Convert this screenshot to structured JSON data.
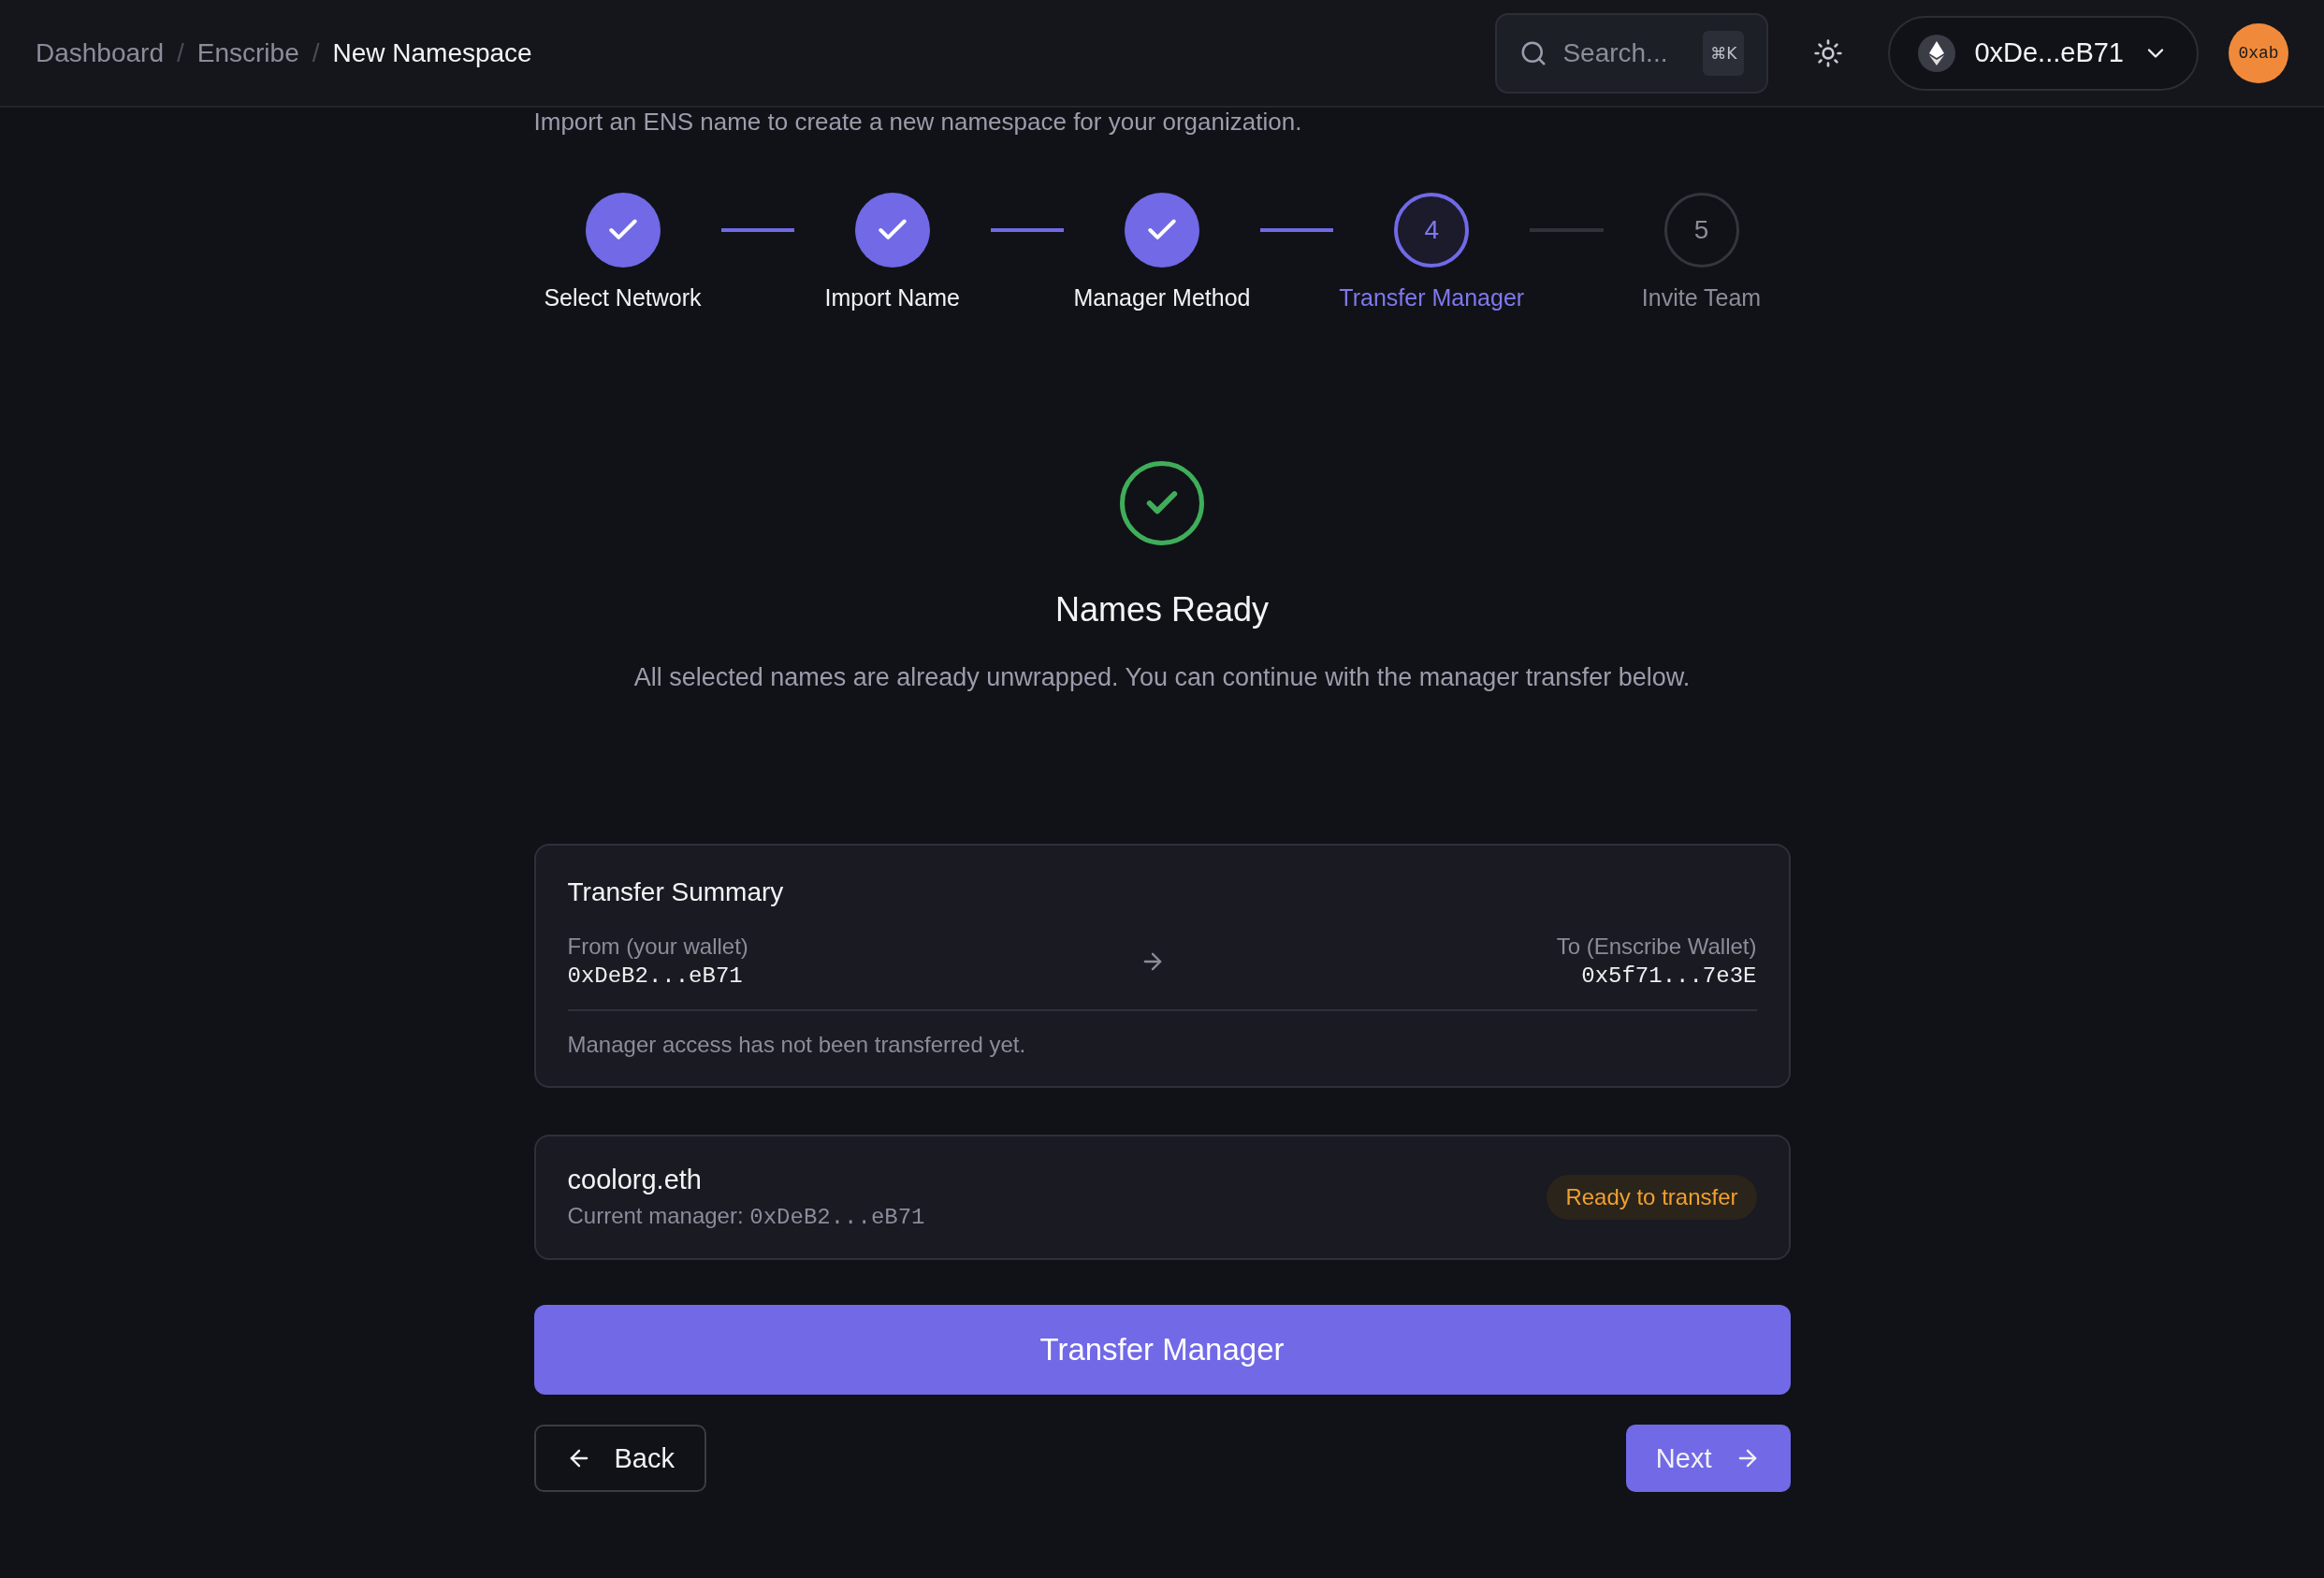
{
  "breadcrumbs": [
    {
      "label": "Dashboard",
      "current": false
    },
    {
      "label": "Enscribe",
      "current": false
    },
    {
      "label": "New Namespace",
      "current": true
    }
  ],
  "breadcrumb_separator": "/",
  "search": {
    "placeholder": "Search...",
    "shortcut": "⌘K"
  },
  "wallet": {
    "label": "0xDe...eB71"
  },
  "avatar": {
    "label": "0xab"
  },
  "subtitle": "Import an ENS name to create a new namespace for your organization.",
  "steps": [
    {
      "label": "Select Network",
      "completed": true,
      "selected": false
    },
    {
      "label": "Import Name",
      "completed": true,
      "selected": false
    },
    {
      "label": "Manager Method",
      "completed": true,
      "selected": false
    },
    {
      "label": "Transfer Manager",
      "number": "4",
      "completed": false,
      "selected": true
    },
    {
      "label": "Invite Team",
      "number": "5",
      "completed": false,
      "selected": false
    }
  ],
  "status": {
    "title": "Names Ready",
    "message": "All selected names are already unwrapped. You can continue with the manager transfer below."
  },
  "summary": {
    "title": "Transfer Summary",
    "from_label": "From (your wallet)",
    "from_address": "0xDeB2...eB71",
    "to_label": "To (Enscribe Wallet)",
    "to_address": "0x5f71...7e3E",
    "note": "Manager access has not been transferred yet."
  },
  "names": [
    {
      "name": "coolorg.eth",
      "manager_label": "Current manager:",
      "manager_address": "0xDeB2...eB71",
      "badge": "Ready to transfer",
      "color": "#f0a030"
    }
  ],
  "primary_button": "Transfer Manager",
  "back_button": "Back",
  "next_button": "Next"
}
